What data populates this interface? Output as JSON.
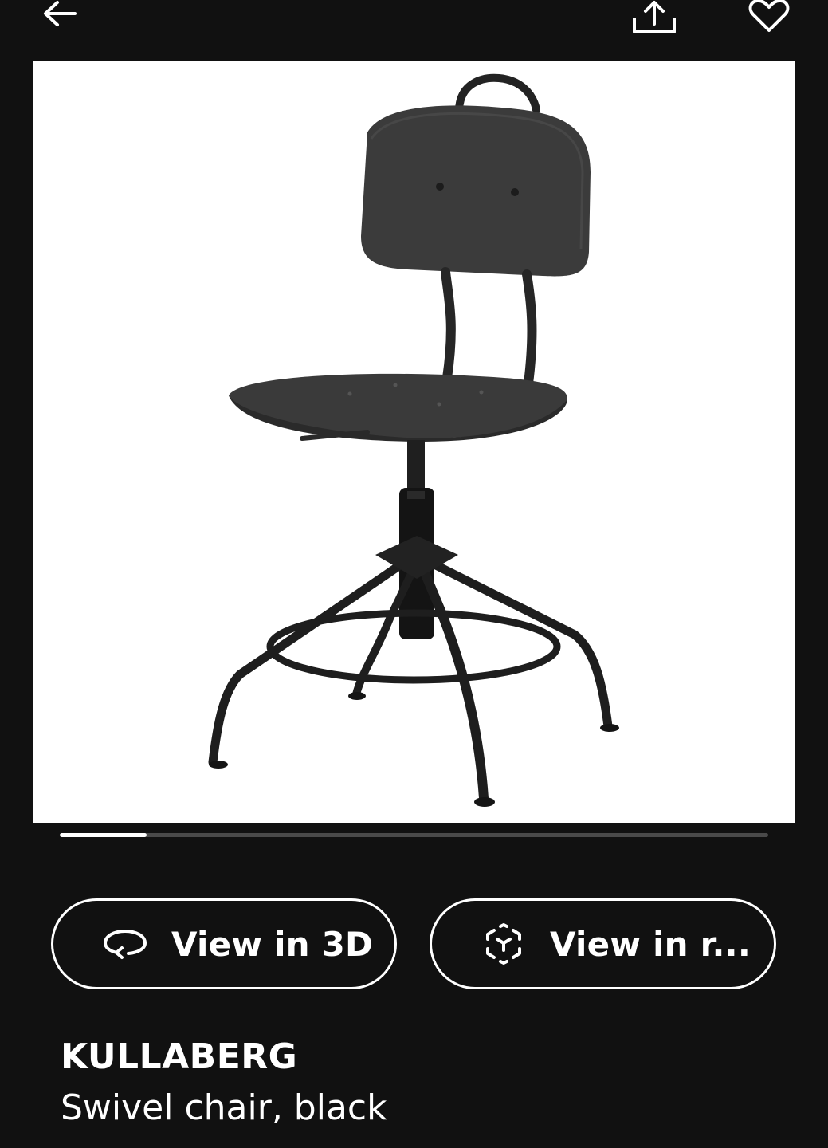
{
  "top_bar": {
    "back_icon": "arrow-left-icon",
    "share_icon": "share-upload-icon",
    "favorite_icon": "heart-outline-icon"
  },
  "product_image": {
    "icon": "swivel-chair-photo",
    "background_color": "#ffffff"
  },
  "carousel": {
    "progress": 0.123
  },
  "actions": {
    "view_3d_label": "View in 3D",
    "view_3d_icon": "rotate-3d-icon",
    "view_room_label": "View in r...",
    "view_room_icon": "augmented-reality-cube-icon"
  },
  "product": {
    "name": "KULLABERG",
    "description": "Swivel chair, black"
  },
  "colors": {
    "background": "#111111",
    "foreground": "#ffffff",
    "track": "#4a4a4a"
  }
}
